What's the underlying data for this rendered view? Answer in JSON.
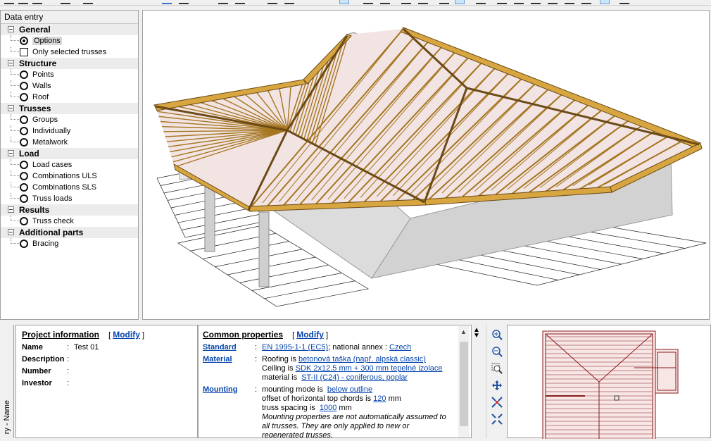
{
  "left_panel": {
    "title": "Data entry",
    "groups": [
      {
        "label": "General",
        "items": [
          {
            "label": "Options",
            "control": "radio",
            "selected": true
          },
          {
            "label": "Only selected trusses",
            "control": "checkbox",
            "selected": false
          }
        ]
      },
      {
        "label": "Structure",
        "items": [
          {
            "label": "Points",
            "control": "radio"
          },
          {
            "label": "Walls",
            "control": "radio"
          },
          {
            "label": "Roof",
            "control": "radio"
          }
        ]
      },
      {
        "label": "Trusses",
        "items": [
          {
            "label": "Groups",
            "control": "radio"
          },
          {
            "label": "Individually",
            "control": "radio"
          },
          {
            "label": "Metalwork",
            "control": "radio"
          }
        ]
      },
      {
        "label": "Load",
        "items": [
          {
            "label": "Load cases",
            "control": "radio"
          },
          {
            "label": "Combinations ULS",
            "control": "radio"
          },
          {
            "label": "Combinations SLS",
            "control": "radio"
          },
          {
            "label": "Truss loads",
            "control": "radio"
          }
        ]
      },
      {
        "label": "Results",
        "items": [
          {
            "label": "Truss check",
            "control": "radio"
          }
        ]
      },
      {
        "label": "Additional parts",
        "items": [
          {
            "label": "Bracing",
            "control": "radio"
          }
        ]
      }
    ]
  },
  "side_tab": {
    "label": "ry - Name"
  },
  "project_info": {
    "heading": "Project information",
    "modify": "Modify",
    "bracket_open": "[",
    "bracket_close": "]",
    "fields": [
      {
        "label": "Name",
        "value": "Test 01"
      },
      {
        "label": "Description",
        "value": ""
      },
      {
        "label": "Number",
        "value": ""
      },
      {
        "label": "Investor",
        "value": ""
      }
    ]
  },
  "common_properties": {
    "heading": "Common properties",
    "modify": "Modify",
    "standard": {
      "label": "Standard",
      "value_link": "EN 1995-1-1 (EC5)",
      "annex_text": "; national annex :",
      "annex_link": "Czech"
    },
    "material": {
      "label": "Material",
      "roofing_text": "Roofing is",
      "roofing_link": "betonová taška (např. alpská classic)",
      "ceiling_text": "Ceiling is",
      "ceiling_link": "SDK 2x12,5 mm + 300 mm tepelné izolace",
      "material_text": "material is",
      "material_link": "ST-II (C24) - coniferous, poplar"
    },
    "mounting": {
      "label": "Mounting",
      "mode_text": "mounting mode is",
      "mode_link": "below outline",
      "offset_text": "offset of horizontal top chords is",
      "offset_value": "120",
      "offset_unit": "mm",
      "spacing_text": "truss spacing is",
      "spacing_value": "1000",
      "spacing_unit": "mm",
      "note_line1": "Mounting properties are not automatically assumed to",
      "note_line2": "all trusses. They are only applied to new or",
      "note_line3": "regenerated trusses."
    }
  },
  "plan_tools": [
    "zoom-in-icon",
    "zoom-out-icon",
    "zoom-window-icon",
    "pan-icon",
    "zoom-extents-icon",
    "zoom-fit-icon"
  ],
  "colors": {
    "timber": "#d8a640",
    "timber_dark": "#6b4a16",
    "wall": "#e2e2e2",
    "roof_tint": "#f2dede",
    "link": "#0645ad",
    "plan_red": "#8b1a1a"
  }
}
